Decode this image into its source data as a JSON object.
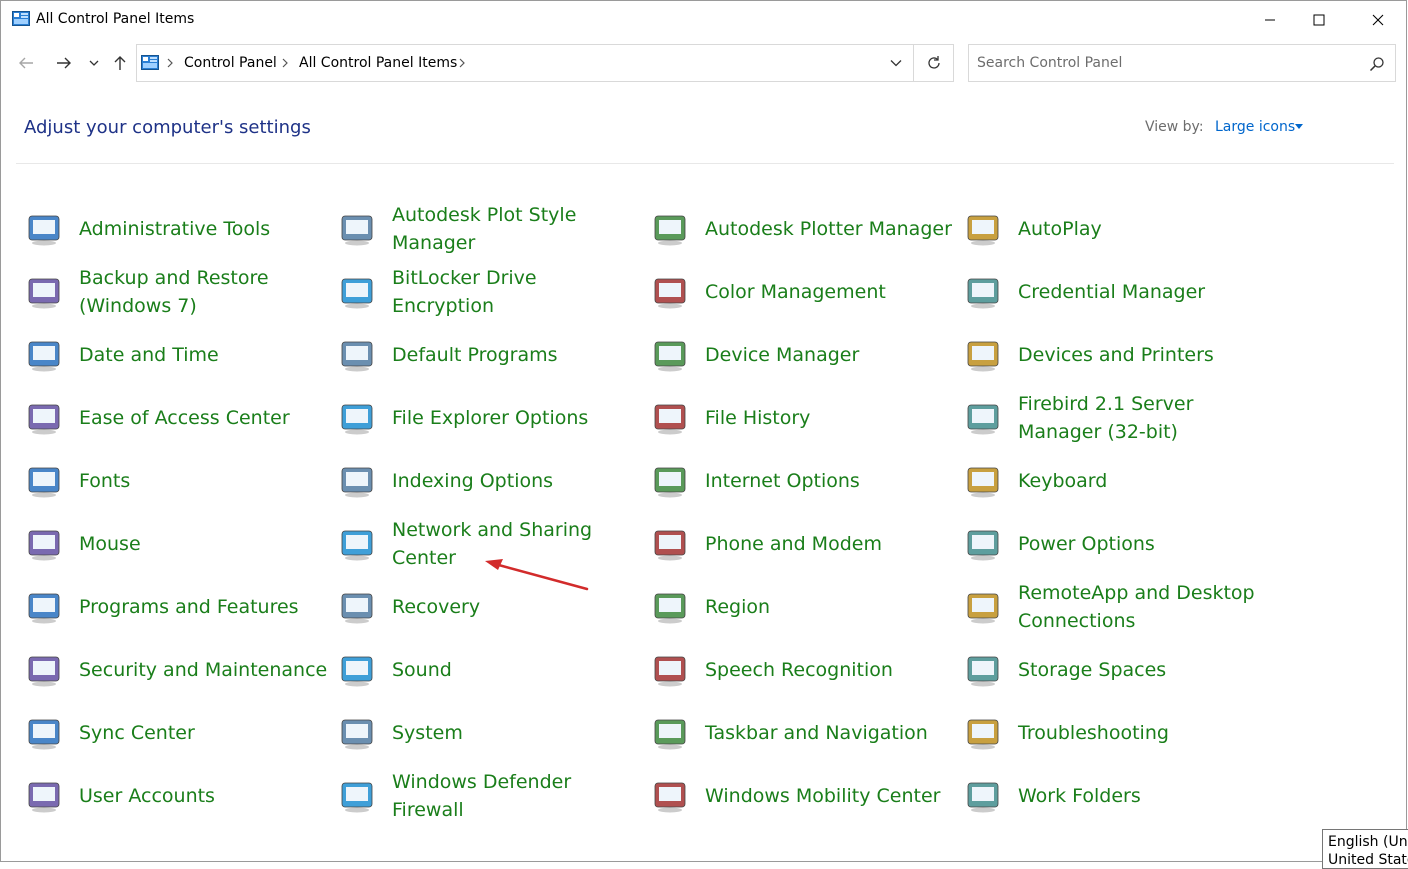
{
  "window": {
    "title": "All Control Panel Items"
  },
  "address": {
    "crumbs": [
      "Control Panel",
      "All Control Panel Items"
    ]
  },
  "search": {
    "placeholder": "Search Control Panel"
  },
  "header": {
    "title": "Adjust your computer's settings",
    "view_by_label": "View by:",
    "view_by_value": "Large icons"
  },
  "items": [
    {
      "label": "Administrative Tools",
      "icon": "administrative-tools-icon"
    },
    {
      "label": "Autodesk Plot Style Manager",
      "icon": "autodesk-plot-style-manager-icon"
    },
    {
      "label": "Autodesk Plotter Manager",
      "icon": "autodesk-plotter-manager-icon"
    },
    {
      "label": "AutoPlay",
      "icon": "autoplay-icon"
    },
    {
      "label": "Backup and Restore (Windows 7)",
      "icon": "backup-and-restore-icon"
    },
    {
      "label": "BitLocker Drive Encryption",
      "icon": "bitlocker-icon"
    },
    {
      "label": "Color Management",
      "icon": "color-management-icon"
    },
    {
      "label": "Credential Manager",
      "icon": "credential-manager-icon"
    },
    {
      "label": "Date and Time",
      "icon": "date-and-time-icon"
    },
    {
      "label": "Default Programs",
      "icon": "default-programs-icon"
    },
    {
      "label": "Device Manager",
      "icon": "device-manager-icon"
    },
    {
      "label": "Devices and Printers",
      "icon": "devices-and-printers-icon"
    },
    {
      "label": "Ease of Access Center",
      "icon": "ease-of-access-icon"
    },
    {
      "label": "File Explorer Options",
      "icon": "file-explorer-options-icon"
    },
    {
      "label": "File History",
      "icon": "file-history-icon"
    },
    {
      "label": "Firebird 2.1 Server Manager (32-bit)",
      "icon": "firebird-server-manager-icon"
    },
    {
      "label": "Fonts",
      "icon": "fonts-icon"
    },
    {
      "label": "Indexing Options",
      "icon": "indexing-options-icon"
    },
    {
      "label": "Internet Options",
      "icon": "internet-options-icon"
    },
    {
      "label": "Keyboard",
      "icon": "keyboard-icon"
    },
    {
      "label": "Mouse",
      "icon": "mouse-icon"
    },
    {
      "label": "Network and Sharing Center",
      "icon": "network-and-sharing-icon"
    },
    {
      "label": "Phone and Modem",
      "icon": "phone-and-modem-icon"
    },
    {
      "label": "Power Options",
      "icon": "power-options-icon"
    },
    {
      "label": "Programs and Features",
      "icon": "programs-and-features-icon"
    },
    {
      "label": "Recovery",
      "icon": "recovery-icon"
    },
    {
      "label": "Region",
      "icon": "region-icon"
    },
    {
      "label": "RemoteApp and Desktop Connections",
      "icon": "remoteapp-icon"
    },
    {
      "label": "Security and Maintenance",
      "icon": "security-and-maintenance-icon"
    },
    {
      "label": "Sound",
      "icon": "sound-icon"
    },
    {
      "label": "Speech Recognition",
      "icon": "speech-recognition-icon"
    },
    {
      "label": "Storage Spaces",
      "icon": "storage-spaces-icon"
    },
    {
      "label": "Sync Center",
      "icon": "sync-center-icon"
    },
    {
      "label": "System",
      "icon": "system-icon"
    },
    {
      "label": "Taskbar and Navigation",
      "icon": "taskbar-and-navigation-icon"
    },
    {
      "label": "Troubleshooting",
      "icon": "troubleshooting-icon"
    },
    {
      "label": "User Accounts",
      "icon": "user-accounts-icon"
    },
    {
      "label": "Windows Defender Firewall",
      "icon": "windows-defender-firewall-icon"
    },
    {
      "label": "Windows Mobility Center",
      "icon": "windows-mobility-center-icon"
    },
    {
      "label": "Work Folders",
      "icon": "work-folders-icon"
    }
  ],
  "tooltip": {
    "line1": "English (Unit",
    "line2": "United State"
  },
  "colors": {
    "item_text": "#1a7e1a",
    "heading": "#1e3287",
    "link": "#0066cc",
    "annotation_arrow": "#d22b2b"
  }
}
